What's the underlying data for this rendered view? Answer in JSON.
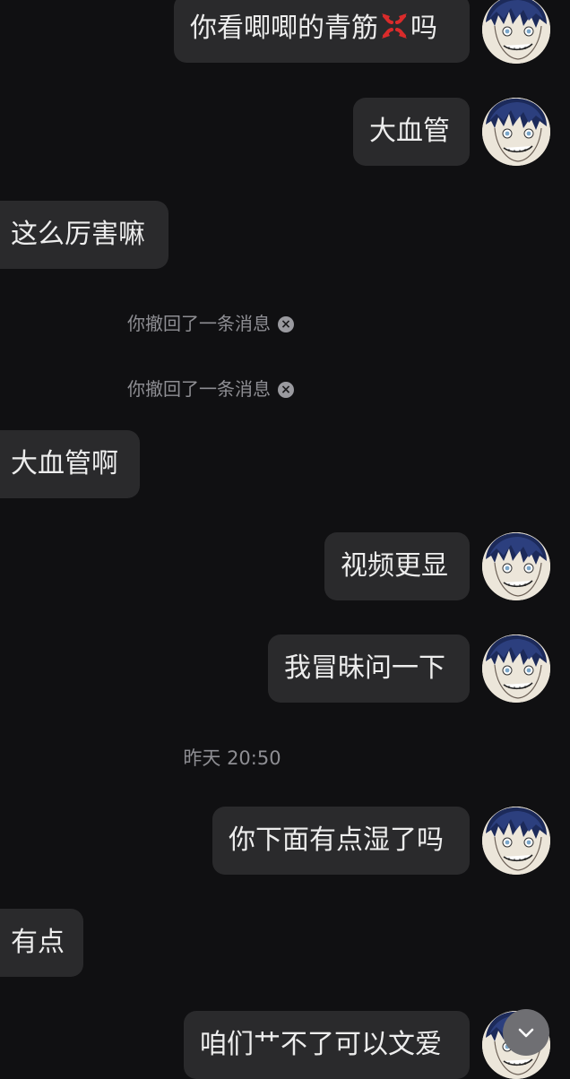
{
  "messages": [
    {
      "part_a": "你看唧唧的青筋",
      "emoji": "anger-symbol-emoji",
      "part_b": "吗"
    },
    {
      "text": "大血管"
    },
    {
      "text": "这么厉害嘛"
    },
    {
      "text": "你撤回了一条消息"
    },
    {
      "text": "你撤回了一条消息"
    },
    {
      "text": "大血管啊"
    },
    {
      "text": "视频更显"
    },
    {
      "text": "我冒昧问一下"
    },
    {
      "text": "昨天 20:50"
    },
    {
      "text": "你下面有点湿了吗"
    },
    {
      "text": "有点"
    },
    {
      "text": "咱们艹不了可以文爱"
    }
  ],
  "icons": {
    "recall": "close-circle-icon",
    "scroll": "chevron-down-icon",
    "avatar": "anime-character-avatar"
  },
  "colors": {
    "background": "#101012",
    "bubble": "#2a2a2c",
    "text": "#ededed",
    "system_text": "#8e8e93",
    "anger_emoji": "#d92b2b"
  }
}
